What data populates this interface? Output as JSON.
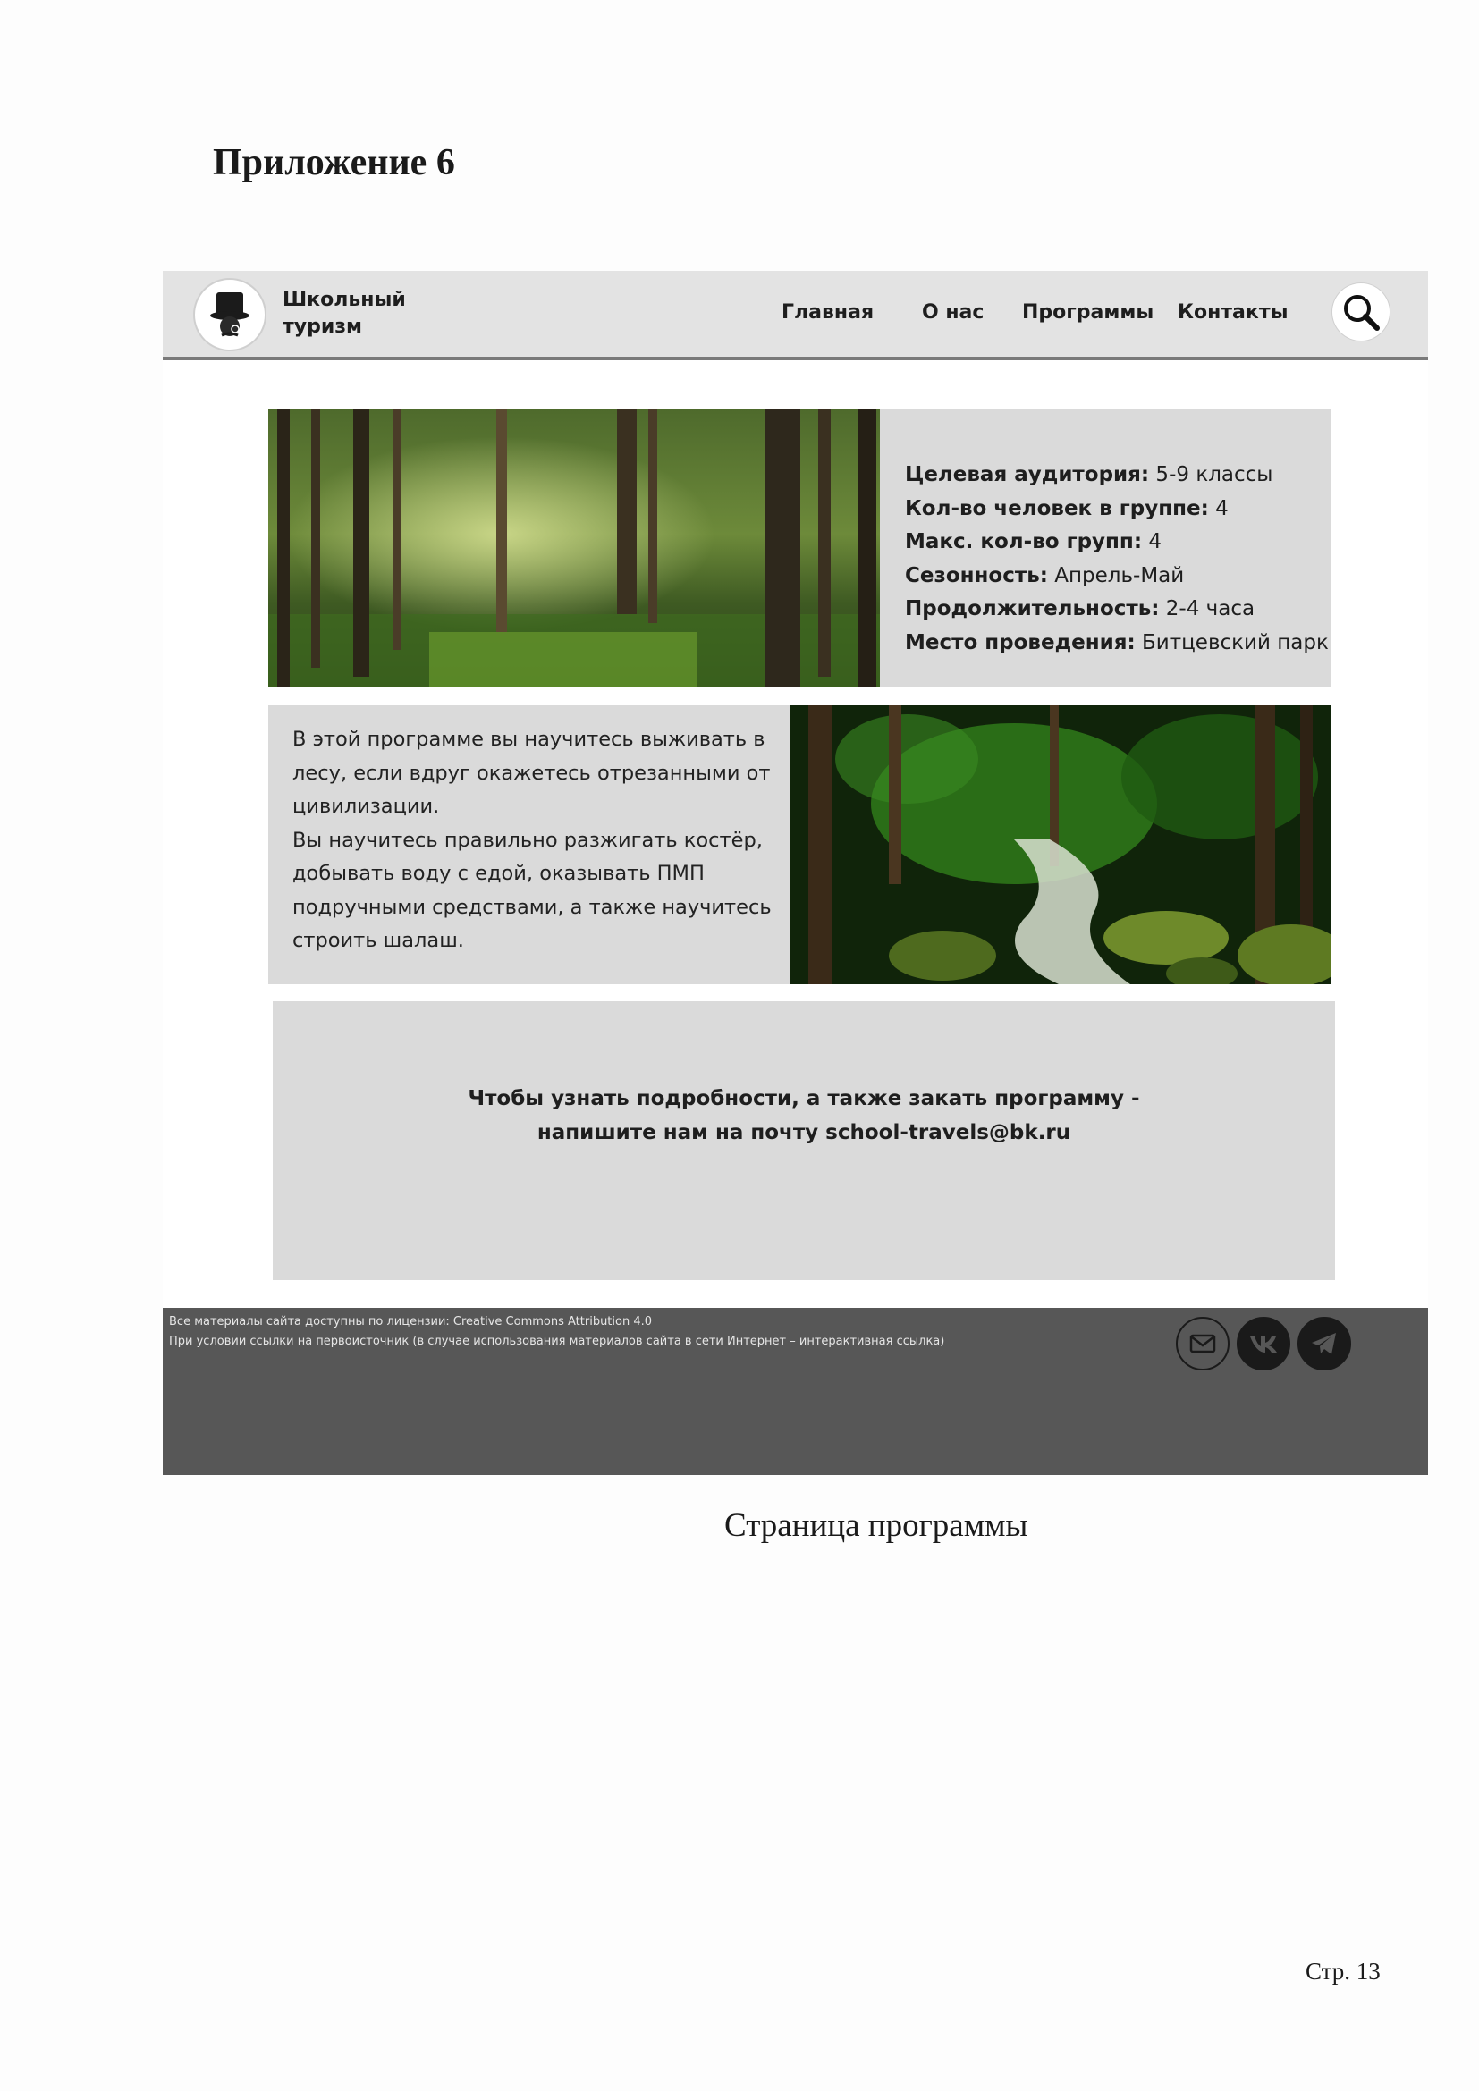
{
  "heading": "Приложение 6",
  "site": {
    "logo_line1": "Школьный",
    "logo_line2": "туризм",
    "nav": [
      "Главная",
      "О нас",
      "Программы",
      "Контакты"
    ],
    "info": [
      {
        "label": "Целевая аудитория:",
        "value": " 5-9 классы"
      },
      {
        "label": "Кол-во человек в группе:",
        "value": " 4"
      },
      {
        "label": "Макс. кол-во групп:",
        "value": " 4"
      },
      {
        "label": "Сезонность:",
        "value": " Апрель-Май"
      },
      {
        "label": "Продолжительность:",
        "value": " 2-4 часа"
      },
      {
        "label": "Место проведения:",
        "value": " Битцевский парк"
      }
    ],
    "description": [
      "В этой программе вы научитесь выживать в",
      "лесу, если вдруг окажетесь отрезанными от",
      "цивилизации.",
      "Вы научитесь правильно разжигать костёр,",
      "добывать воду с едой, оказывать ПМП",
      "подручными средствами, а также научитесь",
      "строить шалаш."
    ],
    "contact_line1": "Чтобы узнать подробности, а также закать программу -",
    "contact_line2": "напишите нам на почту school-travels@bk.ru",
    "footer_line1": "Все материалы сайта доступны по лицензии: Creative Commons Attribution 4.0",
    "footer_line2": "При условии ссылки на первоисточник (в случае использования материалов сайта в сети Интернет – интерактивная ссылка)",
    "icons": [
      "logo-hat-icon",
      "search-icon",
      "mail-icon",
      "vk-icon",
      "telegram-icon"
    ],
    "colors": {
      "header": "#e3e3e3",
      "panel": "#dadada",
      "footer": "#575757"
    }
  },
  "caption": "Страница программы",
  "page_number": "Стр. 13"
}
